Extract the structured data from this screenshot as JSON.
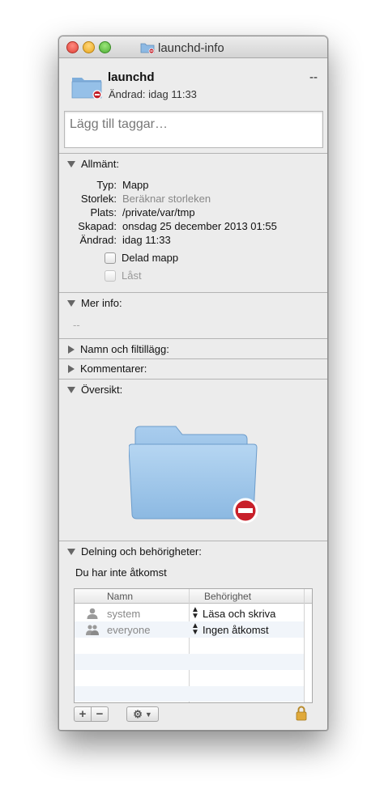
{
  "window": {
    "title": "launchd-info"
  },
  "header": {
    "name": "launchd",
    "size_placeholder": "--",
    "modified": "Ändrad:  idag 11:33"
  },
  "tags": {
    "placeholder": "Lägg till taggar…"
  },
  "sections": {
    "general": "Allmänt:",
    "more_info": "Mer info:",
    "name_ext": "Namn och filtillägg:",
    "comments": "Kommentarer:",
    "preview": "Översikt:",
    "sharing": "Delning och behörigheter:"
  },
  "general": {
    "rows": [
      {
        "key": "Typ:",
        "value": "Mapp"
      },
      {
        "key": "Storlek:",
        "value": "Beräknar storleken"
      },
      {
        "key": "Plats:",
        "value": "/private/var/tmp"
      },
      {
        "key": "Skapad:",
        "value": "onsdag 25 december 2013 01:55"
      },
      {
        "key": "Ändrad:",
        "value": "idag 11:33"
      }
    ],
    "shared_folder": "Delad mapp",
    "locked": "Låst"
  },
  "more_info": {
    "value": "--"
  },
  "sharing": {
    "notice": "Du har inte åtkomst",
    "columns": [
      "Namn",
      "Behörighet"
    ],
    "rows": [
      {
        "name": "system",
        "privilege": "Läsa och skriva",
        "icon": "user-icon"
      },
      {
        "name": "everyone",
        "privilege": "Ingen åtkomst",
        "icon": "group-icon"
      }
    ],
    "add": "+",
    "remove": "−"
  }
}
